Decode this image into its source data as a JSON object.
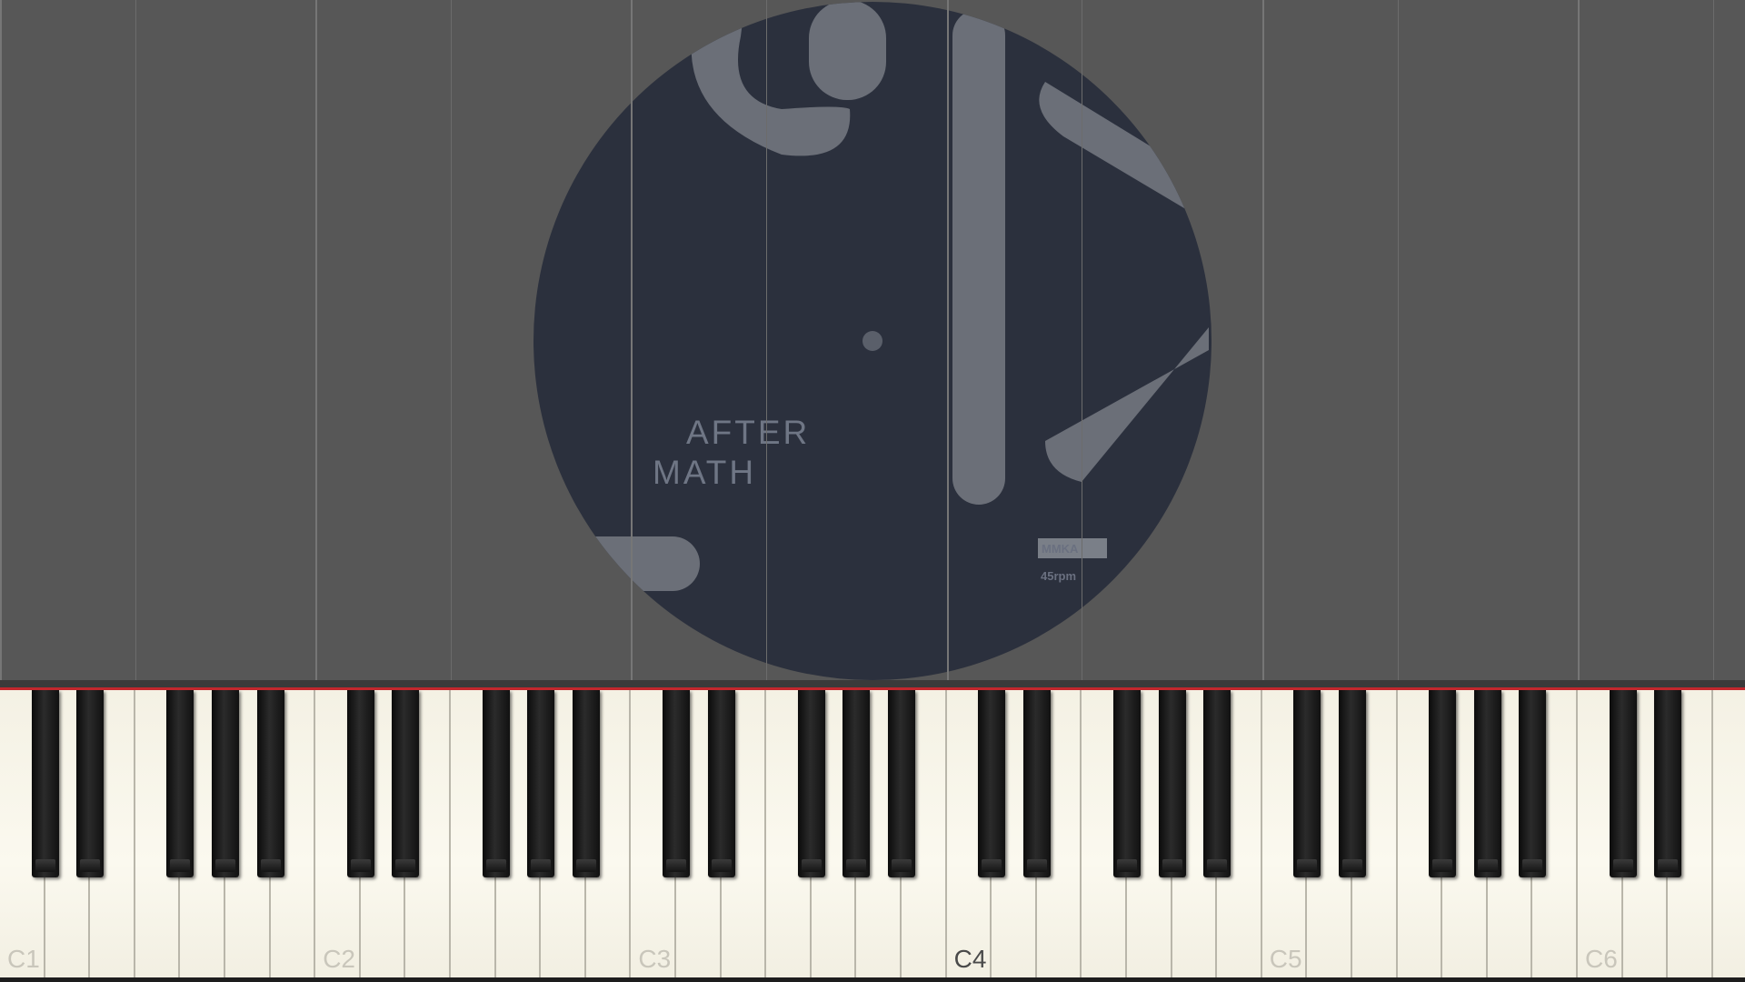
{
  "visualizer": {
    "cover_art": {
      "title_line1": "AFTER",
      "title_line2": "MATH",
      "label_logo": "MMKA",
      "speed": "45rpm"
    }
  },
  "keyboard": {
    "octave_labels": [
      "C1",
      "C2",
      "C3",
      "C4",
      "C5",
      "C6"
    ],
    "active_label": "C4"
  },
  "colors": {
    "background": "#575757",
    "red_line": "#c2272d",
    "white_key": "#f8f6eb",
    "black_key": "#111111",
    "cover_disc": "#2b303d"
  }
}
